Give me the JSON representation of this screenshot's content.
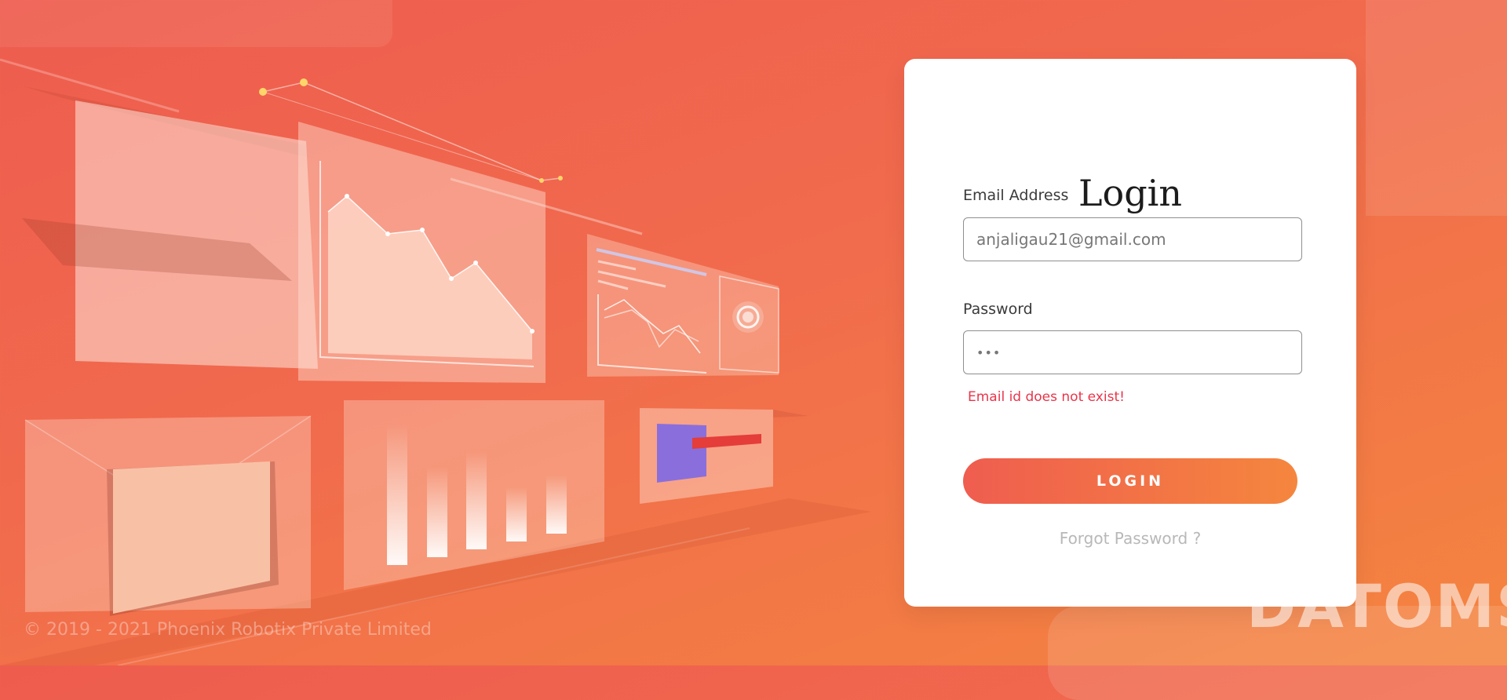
{
  "login": {
    "title": "Login",
    "email_label": "Email Address",
    "email_value": "anjaligau21@gmail.com",
    "password_label": "Password",
    "password_value": "•••",
    "error": "Email id does not exist!",
    "button_label": "LOGIN",
    "forgot_label": "Forgot Password ?"
  },
  "footer": {
    "copyright": "© 2019 - 2021 Phoenix Robotix Private Limited"
  },
  "brand": {
    "logo_text": "DATOMS"
  },
  "colors": {
    "accent_start": "#ef5d4f",
    "accent_end": "#f5863e",
    "error": "#e8354a"
  }
}
